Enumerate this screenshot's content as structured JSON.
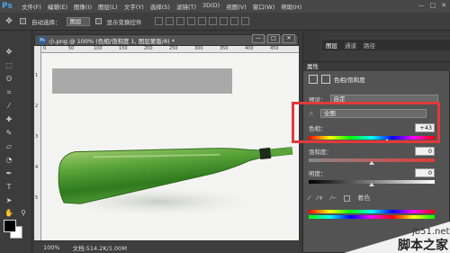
{
  "app": {
    "logo": "Ps"
  },
  "menu": [
    "文件(F)",
    "编辑(E)",
    "图像(I)",
    "图层(L)",
    "文字(Y)",
    "选择(S)",
    "滤镜(T)",
    "3D(D)",
    "视图(V)",
    "窗口(W)",
    "帮助(H)"
  ],
  "window_controls": [
    "—",
    "□",
    "✕"
  ],
  "options": {
    "auto_select_label": "自动选择：",
    "auto_select_value": "图层",
    "transform_label": "显示变换控件"
  },
  "document": {
    "tab_title": "小.png @ 100% (色相/饱和度 1, 图层蒙版/8) *",
    "zoom": "100%",
    "doc_info": "文档:514.2K/1.00M"
  },
  "ruler_top": [
    "0",
    "50",
    "100",
    "150",
    "200",
    "250",
    "300",
    "350",
    "400",
    "450"
  ],
  "ruler_left": [
    "1",
    "2",
    "3",
    "4",
    "5"
  ],
  "panel_tabs": [
    "图层",
    "通道",
    "路径"
  ],
  "properties": {
    "header": "属性",
    "adjustment_title": "色相/饱和度",
    "preset_label": "预设：",
    "preset_value": "自定",
    "channel_value": "全图",
    "hue_label": "色相：",
    "hue_value": "+43",
    "hue_amount": 43,
    "saturation_label": "饱和度：",
    "saturation_value": "0",
    "lightness_label": "明度：",
    "lightness_value": "0",
    "colorize_label": "着色"
  },
  "watermark": {
    "site": "jb51.net",
    "name": "脚本之家"
  },
  "colors": {
    "highlight": "#e23a3a",
    "bottle": "#3f8f2a",
    "canvas_bg": "#f4f4f2"
  }
}
